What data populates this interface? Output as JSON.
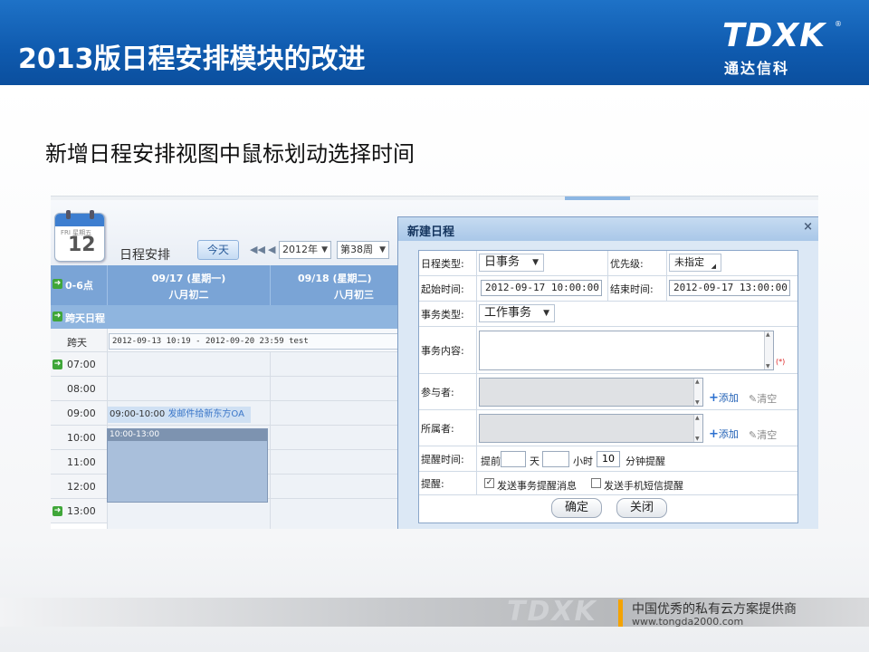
{
  "slide": {
    "title": "2013版日程安排模块的改进",
    "subtitle": "新增日程安排视图中鼠标划动选择时间",
    "logo_mark": "TDXK",
    "logo_sub": "通达信科",
    "logo_reg": "®",
    "footer_ghost": "TDXK",
    "footer_slogan": "中国优秀的私有云方案提供商",
    "footer_url": "www.tongda2000.com",
    "colors": {
      "header_blue": "#1262b8",
      "accent_orange": "#f4a300"
    }
  },
  "calendar": {
    "icon_weekday": "FRI 星期五",
    "icon_day": "12",
    "title": "日程安排",
    "today_label": "今天",
    "year_select": "2012年",
    "week_select": "第38周",
    "range_label": "0-6点",
    "days": [
      {
        "date": "09/17 (星期一)",
        "lunar": "八月初二"
      },
      {
        "date": "09/18 (星期二)",
        "lunar": "八月初三"
      }
    ],
    "cross_day_header": "跨天日程",
    "cross_day_label": "跨天",
    "cross_day_event": "2012-09-13 10:19 - 2012-09-20 23:59 test",
    "hours": [
      "07:00",
      "08:00",
      "09:00",
      "10:00",
      "11:00",
      "12:00",
      "13:00"
    ],
    "event": {
      "time": "09:00-10:00",
      "subject": "发邮件给新东方OA"
    },
    "selection_label": "10:00-13:00"
  },
  "dialog": {
    "title": "新建日程",
    "close": "×",
    "type_label": "日程类型:",
    "type_value": "日事务",
    "priority_label": "优先级:",
    "priority_value": "未指定",
    "start_label": "起始时间:",
    "start_value": "2012-09-17 10:00:00",
    "end_label": "结束时间:",
    "end_value": "2012-09-17 13:00:00",
    "task_type_label": "事务类型:",
    "task_type_value": "工作事务",
    "content_label": "事务内容:",
    "required_mark": "(*)",
    "participants_label": "参与者:",
    "owner_label": "所属者:",
    "add_label": "添加",
    "clear_label": "清空",
    "remind_time_label": "提醒时间:",
    "remind_before": "提前",
    "remind_day": "天",
    "remind_hour": "小时",
    "remind_minutes_value": "10",
    "remind_minutes_suffix": "分钟提醒",
    "remind_label": "提醒:",
    "send_message_label": "发送事务提醒消息",
    "send_message_checked": true,
    "send_sms_label": "发送手机短信提醒",
    "send_sms_checked": false,
    "ok_label": "确定",
    "close_label": "关闭"
  }
}
